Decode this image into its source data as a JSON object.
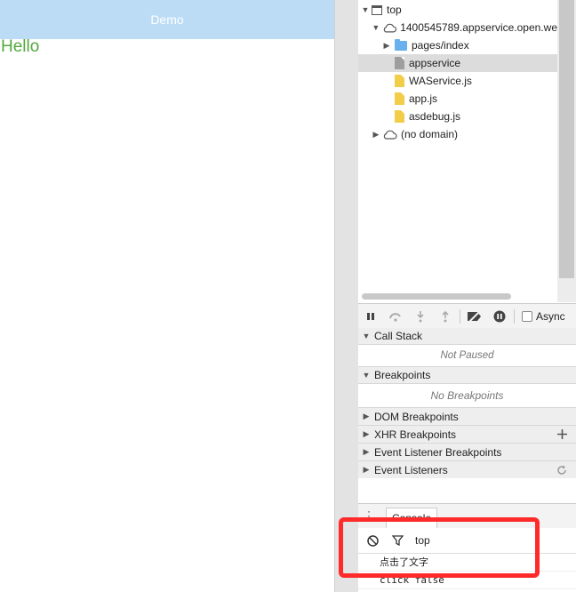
{
  "simulator": {
    "nav_title": "Demo",
    "body_text": "Hello"
  },
  "tree": {
    "items": [
      {
        "label": "top",
        "kind": "frame"
      },
      {
        "label": "1400545789.appservice.open.we",
        "kind": "cloud"
      },
      {
        "label": "pages/index",
        "kind": "folder"
      },
      {
        "label": "appservice",
        "kind": "file-gray",
        "selected": true
      },
      {
        "label": "WAService.js",
        "kind": "file-js"
      },
      {
        "label": "app.js",
        "kind": "file-js"
      },
      {
        "label": "asdebug.js",
        "kind": "file-js"
      },
      {
        "label": "(no domain)",
        "kind": "cloud"
      }
    ]
  },
  "debugger": {
    "async_label": "Async",
    "panes": {
      "call_stack": {
        "title": "Call Stack",
        "empty": "Not Paused"
      },
      "breakpoints": {
        "title": "Breakpoints",
        "empty": "No Breakpoints"
      },
      "dom_breakpoints": "DOM Breakpoints",
      "xhr_breakpoints": "XHR Breakpoints",
      "event_listener_breakpoints": "Event Listener Breakpoints",
      "event_listeners": "Event Listeners"
    }
  },
  "console": {
    "tab_label": "Console",
    "context": "top",
    "messages": [
      "点击了文字",
      "click false"
    ]
  },
  "colors": {
    "nav_bar": "#bcdcf6",
    "hello_text": "#53a83d",
    "highlight": "#ff2a2a"
  }
}
